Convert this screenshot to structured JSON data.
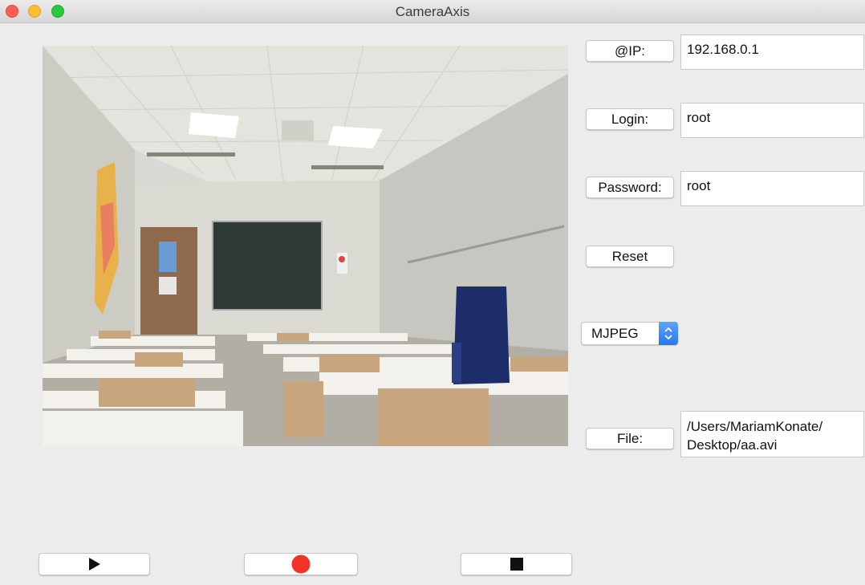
{
  "window": {
    "title": "CameraAxis"
  },
  "connection": {
    "ip_label": "@IP:",
    "ip_value": "192.168.0.1",
    "login_label": "Login:",
    "login_value": "root",
    "password_label": "Password:",
    "password_value": "root",
    "reset_label": "Reset"
  },
  "codec": {
    "selected": "MJPEG"
  },
  "file": {
    "label": "File:",
    "path_line1": "/Users/MariamKonate/",
    "path_line2": "Desktop/aa.avi"
  },
  "controls": {
    "play_icon": "play-icon",
    "record_icon": "record-icon",
    "stop_icon": "stop-icon"
  },
  "colors": {
    "record_red": "#f4322a",
    "select_blue": "#2a77ee",
    "window_bg": "#ececec"
  }
}
